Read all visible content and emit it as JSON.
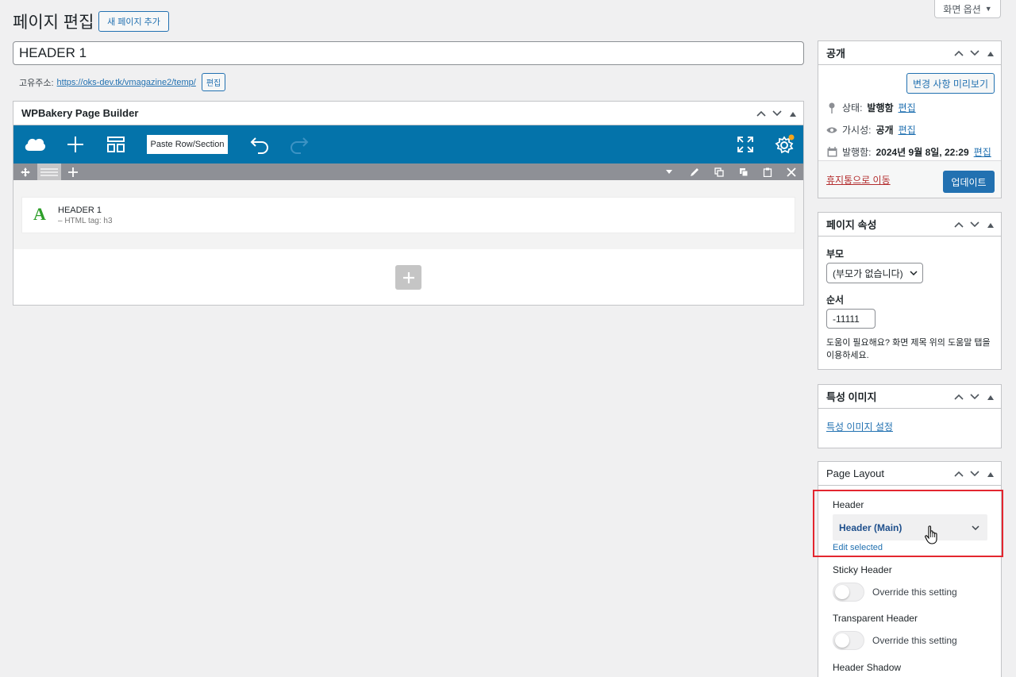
{
  "screen_options": {
    "label": "화면 옵션",
    "caret": "▼"
  },
  "header": {
    "title": "페이지 편집",
    "add_new": "새 페이지 추가"
  },
  "post": {
    "title_value": "HEADER 1",
    "permalink_label": "고유주소:",
    "permalink_url": "https://oks-dev.tk/vmagazine2/temp/",
    "permalink_edit": "편집"
  },
  "builder": {
    "title": "WPBakery Page Builder",
    "paste_label": "Paste Row/Section",
    "element_title": "HEADER 1",
    "element_sub": "– HTML tag: h3",
    "element_icon": "A"
  },
  "publish": {
    "title": "공개",
    "preview": "변경 사항 미리보기",
    "status_label": "상태:",
    "status_value": "발행함",
    "visibility_label": "가시성:",
    "visibility_value": "공개",
    "published_label": "발행함:",
    "published_value": "2024년 9월 8일, 22:29",
    "edit": "편집",
    "trash": "휴지통으로 이동",
    "update": "업데이트"
  },
  "page_attributes": {
    "title": "페이지 속성",
    "parent_label": "부모",
    "parent_value": "(부모가 없습니다)",
    "order_label": "순서",
    "order_value": "-11111",
    "help": "도움이 필요해요? 화면 제목 위의 도움말 탭을 이용하세요."
  },
  "featured_image": {
    "title": "특성 이미지",
    "link": "특성 이미지 설정"
  },
  "page_layout": {
    "title": "Page Layout",
    "header_label": "Header",
    "header_value": "Header (Main)",
    "edit_selected": "Edit selected",
    "sticky_label": "Sticky Header",
    "sticky_toggle": "Override this setting",
    "transparent_label": "Transparent Header",
    "transparent_toggle": "Override this setting",
    "shadow_label": "Header Shadow"
  },
  "colors": {
    "accent": "#2271b1",
    "toolbar": "#0473aa",
    "highlight": "#e3262f"
  }
}
